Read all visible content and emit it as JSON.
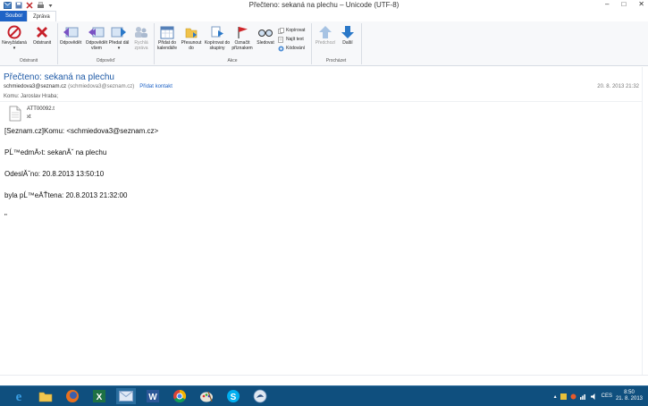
{
  "window": {
    "title": "Přečteno: sekaná na plechu – Unicode (UTF-8)",
    "min_label": "–",
    "max_label": "□",
    "close_label": "✕"
  },
  "tabs": [
    {
      "label": "Soubor"
    },
    {
      "label": "Zpráva"
    }
  ],
  "ribbon": {
    "groups": [
      {
        "label": "Odstranit"
      },
      {
        "label": "Odpověď"
      },
      {
        "label": "Akce"
      },
      {
        "label": "Procházet"
      }
    ],
    "buttons": {
      "junk": "Nevyžádaná",
      "delete": "Odstranit",
      "reply": "Odpovědět",
      "reply_all": "Odpovědět všem",
      "forward": "Předat dál",
      "quick_reply": "Rychlá zpráva",
      "add_calendar": "Přidat do kalendáře",
      "move_to": "Přesunout do",
      "copy_to": "Kopírovat do skupiny",
      "flag": "Označit příznakem",
      "watch": "Sledovat",
      "copy": "Kopírovat",
      "find_text": "Najít text",
      "encoding": "Kódování",
      "previous": "Předchozí",
      "next": "Další"
    }
  },
  "message": {
    "subject": "Přečteno: sekaná na plechu",
    "from_name": "schmiedova3@seznam.cz",
    "from_email": "(schmiedova3@seznam.cz)",
    "add_contact": "Přidat kontakt",
    "date": "20. 8. 2013 21:32",
    "to": "Komu: Jaroslav Hraba;",
    "attachment": {
      "name": "ATT00092.t",
      "name_line2": "xt"
    },
    "body_lines": [
      "[Seznam.cz]Komu: <schmiedova3@seznam.cz>",
      "PĹ™edmÄ›t: sekanĂˇ na plechu",
      "OdeslĂˇno: 20.8.2013 13:50:10",
      "byla pĹ™eÄŤtena: 20.8.2013 21:32:00",
      "\""
    ]
  },
  "taskbar": {
    "language": "CES",
    "time": "8:50",
    "date": "21. 8. 2013"
  },
  "colors": {
    "accent": "#1f63c6",
    "taskbar": "#0f4f7e",
    "subject": "#1f5aa6"
  }
}
